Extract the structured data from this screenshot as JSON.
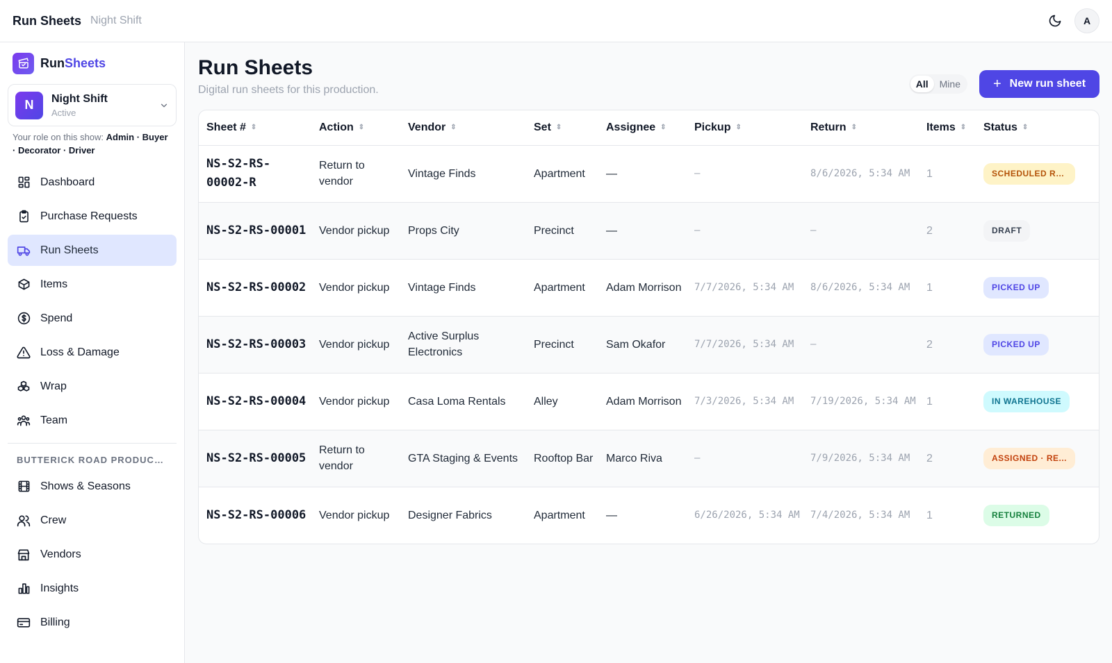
{
  "topbar": {
    "app_title": "Run Sheets",
    "show_name": "Night Shift",
    "avatar_letter": "A"
  },
  "sidebar": {
    "brand_part1": "Run",
    "brand_part2": "Sheets",
    "show": {
      "letter": "N",
      "name": "Night Shift",
      "status": "Active"
    },
    "role_prefix": "Your role on this show:",
    "roles": "Admin · Buyer · Decorator · Driver",
    "items": [
      {
        "label": "Dashboard",
        "icon": "dashboard-icon"
      },
      {
        "label": "Purchase Requests",
        "icon": "clipboard-check-icon"
      },
      {
        "label": "Run Sheets",
        "icon": "truck-icon",
        "active": true
      },
      {
        "label": "Items",
        "icon": "box-icon"
      },
      {
        "label": "Spend",
        "icon": "dollar-circle-icon"
      },
      {
        "label": "Loss & Damage",
        "icon": "warning-triangle-icon"
      },
      {
        "label": "Wrap",
        "icon": "boxes-stack-icon"
      },
      {
        "label": "Team",
        "icon": "team-icon"
      }
    ],
    "org_label": "BUTTERICK ROAD PRODUCTI...",
    "org_items": [
      {
        "label": "Shows & Seasons",
        "icon": "film-icon"
      },
      {
        "label": "Crew",
        "icon": "users-icon"
      },
      {
        "label": "Vendors",
        "icon": "storefront-icon"
      },
      {
        "label": "Insights",
        "icon": "bar-chart-icon"
      },
      {
        "label": "Billing",
        "icon": "credit-card-icon"
      }
    ]
  },
  "main": {
    "title": "Run Sheets",
    "subtitle": "Digital run sheets for this production.",
    "filter": {
      "all": "All",
      "mine": "Mine",
      "selected": "All"
    },
    "new_button": "New run sheet",
    "columns": [
      "Sheet #",
      "Action",
      "Vendor",
      "Set",
      "Assignee",
      "Pickup",
      "Return",
      "Items",
      "Status"
    ],
    "rows": [
      {
        "sheet": "NS-S2-RS-00002-R",
        "action": "Return to vendor",
        "vendor": "Vintage Finds",
        "set": "Apartment",
        "assignee": "—",
        "pickup": "–",
        "return": "8/6/2026, 5:34 AM",
        "items": "1",
        "status": "SCHEDULED RE...",
        "status_color": "#b45309",
        "status_bg": "#fef3c7"
      },
      {
        "sheet": "NS-S2-RS-00001",
        "action": "Vendor pickup",
        "vendor": "Props City",
        "set": "Precinct",
        "assignee": "—",
        "pickup": "–",
        "return": "–",
        "items": "2",
        "status": "DRAFT",
        "status_color": "#374151",
        "status_bg": "#f3f4f6"
      },
      {
        "sheet": "NS-S2-RS-00002",
        "action": "Vendor pickup",
        "vendor": "Vintage Finds",
        "set": "Apartment",
        "assignee": "Adam Morrison",
        "pickup": "7/7/2026, 5:34 AM",
        "return": "8/6/2026, 5:34 AM",
        "items": "1",
        "status": "PICKED UP",
        "status_color": "#4f46e5",
        "status_bg": "#e0e7ff"
      },
      {
        "sheet": "NS-S2-RS-00003",
        "action": "Vendor pickup",
        "vendor": "Active Surplus Electronics",
        "set": "Precinct",
        "assignee": "Sam Okafor",
        "pickup": "7/7/2026, 5:34 AM",
        "return": "–",
        "items": "2",
        "status": "PICKED UP",
        "status_color": "#4f46e5",
        "status_bg": "#e0e7ff"
      },
      {
        "sheet": "NS-S2-RS-00004",
        "action": "Vendor pickup",
        "vendor": "Casa Loma Rentals",
        "set": "Alley",
        "assignee": "Adam Morrison",
        "pickup": "7/3/2026, 5:34 AM",
        "return": "7/19/2026, 5:34 AM",
        "items": "1",
        "status": "IN WAREHOUSE",
        "status_color": "#0e7490",
        "status_bg": "#cffafe"
      },
      {
        "sheet": "NS-S2-RS-00005",
        "action": "Return to vendor",
        "vendor": "GTA Staging & Events",
        "set": "Rooftop Bar",
        "assignee": "Marco Riva",
        "pickup": "–",
        "return": "7/9/2026, 5:34 AM",
        "items": "2",
        "status": "ASSIGNED · RE...",
        "status_color": "#c2410c",
        "status_bg": "#ffedd5"
      },
      {
        "sheet": "NS-S2-RS-00006",
        "action": "Vendor pickup",
        "vendor": "Designer Fabrics",
        "set": "Apartment",
        "assignee": "—",
        "pickup": "6/26/2026, 5:34 AM",
        "return": "7/4/2026, 5:34 AM",
        "items": "1",
        "status": "RETURNED",
        "status_color": "#15803d",
        "status_bg": "#dcfce7"
      }
    ]
  }
}
